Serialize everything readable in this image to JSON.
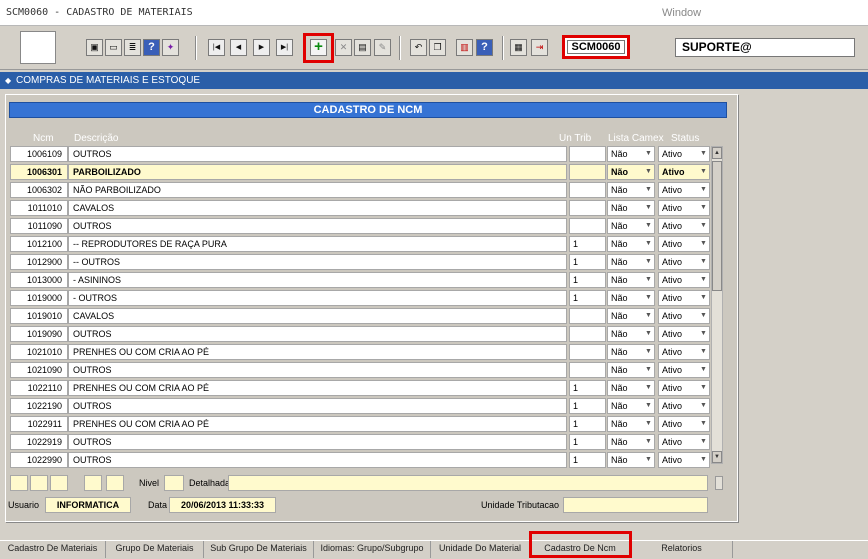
{
  "window": {
    "title": "SCM0060 - CADASTRO DE MATERIAIS",
    "menu": "Window"
  },
  "toolbar": {
    "screen_code": "SCM0060",
    "user": "SUPORTE@",
    "icons": [
      "save-icon",
      "window-icon",
      "print-icon",
      "query-icon",
      "wand-icon",
      "first-record-icon",
      "prev-record-icon",
      "next-record-icon",
      "last-record-icon",
      "add-record-icon",
      "delete-record-icon",
      "form-icon",
      "edit-icon",
      "undo-icon",
      "copy-icon",
      "list-icon",
      "help-icon",
      "menu-icon",
      "exit-icon"
    ]
  },
  "module": {
    "title": "COMPRAS DE MATERIAIS E ESTOQUE"
  },
  "panel": {
    "title": "CADASTRO DE NCM"
  },
  "columns": {
    "ncm": "Ncm",
    "desc": "Descrição",
    "trib": "Un Trib",
    "lista": "Lista Camex",
    "status": "Status"
  },
  "rows": [
    {
      "ncm": "1006109",
      "desc": "OUTROS",
      "trib": "",
      "lista": "Não",
      "status": "Ativo"
    },
    {
      "ncm": "1006301",
      "desc": "PARBOILIZADO",
      "trib": "",
      "lista": "Não",
      "status": "Ativo"
    },
    {
      "ncm": "1006302",
      "desc": "NÃO PARBOILIZADO",
      "trib": "",
      "lista": "Não",
      "status": "Ativo"
    },
    {
      "ncm": "1011010",
      "desc": "CAVALOS",
      "trib": "",
      "lista": "Não",
      "status": "Ativo"
    },
    {
      "ncm": "1011090",
      "desc": "OUTROS",
      "trib": "",
      "lista": "Não",
      "status": "Ativo"
    },
    {
      "ncm": "1012100",
      "desc": "-- REPRODUTORES DE RAÇA PURA",
      "trib": "1",
      "lista": "Não",
      "status": "Ativo"
    },
    {
      "ncm": "1012900",
      "desc": "-- OUTROS",
      "trib": "1",
      "lista": "Não",
      "status": "Ativo"
    },
    {
      "ncm": "1013000",
      "desc": "- ASININOS",
      "trib": "1",
      "lista": "Não",
      "status": "Ativo"
    },
    {
      "ncm": "1019000",
      "desc": "- OUTROS",
      "trib": "1",
      "lista": "Não",
      "status": "Ativo"
    },
    {
      "ncm": "1019010",
      "desc": "CAVALOS",
      "trib": "",
      "lista": "Não",
      "status": "Ativo"
    },
    {
      "ncm": "1019090",
      "desc": "OUTROS",
      "trib": "",
      "lista": "Não",
      "status": "Ativo"
    },
    {
      "ncm": "1021010",
      "desc": "PRENHES OU COM CRIA AO PÉ",
      "trib": "",
      "lista": "Não",
      "status": "Ativo"
    },
    {
      "ncm": "1021090",
      "desc": "OUTROS",
      "trib": "",
      "lista": "Não",
      "status": "Ativo"
    },
    {
      "ncm": "1022110",
      "desc": "PRENHES OU COM CRIA AO PÉ",
      "trib": "1",
      "lista": "Não",
      "status": "Ativo"
    },
    {
      "ncm": "1022190",
      "desc": "OUTROS",
      "trib": "1",
      "lista": "Não",
      "status": "Ativo"
    },
    {
      "ncm": "1022911",
      "desc": "PRENHES OU COM CRIA AO PÉ",
      "trib": "1",
      "lista": "Não",
      "status": "Ativo"
    },
    {
      "ncm": "1022919",
      "desc": "OUTROS",
      "trib": "1",
      "lista": "Não",
      "status": "Ativo"
    },
    {
      "ncm": "1022990",
      "desc": "OUTROS",
      "trib": "1",
      "lista": "Não",
      "status": "Ativo"
    }
  ],
  "selected_row": 1,
  "footer": {
    "nivel_label": "Nivel",
    "nivel_value": "",
    "detalhada_label": "Detalhada",
    "detalhada_value": "",
    "usuario_label": "Usuario",
    "usuario_value": "INFORMATICA",
    "data_label": "Data",
    "data_value": "20/06/2013 11:33:33",
    "unidade_label": "Unidade Tributacao",
    "unidade_value": ""
  },
  "tabs": [
    {
      "label": "Cadastro De Materiais"
    },
    {
      "label": "Grupo De Materiais"
    },
    {
      "label": "Sub Grupo De Materiais"
    },
    {
      "label": "Idiomas: Grupo/Subgrupo"
    },
    {
      "label": "Unidade Do Material"
    },
    {
      "label": "Cadastro De Ncm",
      "active": true
    },
    {
      "label": "Relatorios"
    }
  ],
  "colors": {
    "accent": "#3573d4",
    "module_bar": "#2a5ea8",
    "highlight": "#e00000",
    "selected_row": "#fffacd"
  }
}
